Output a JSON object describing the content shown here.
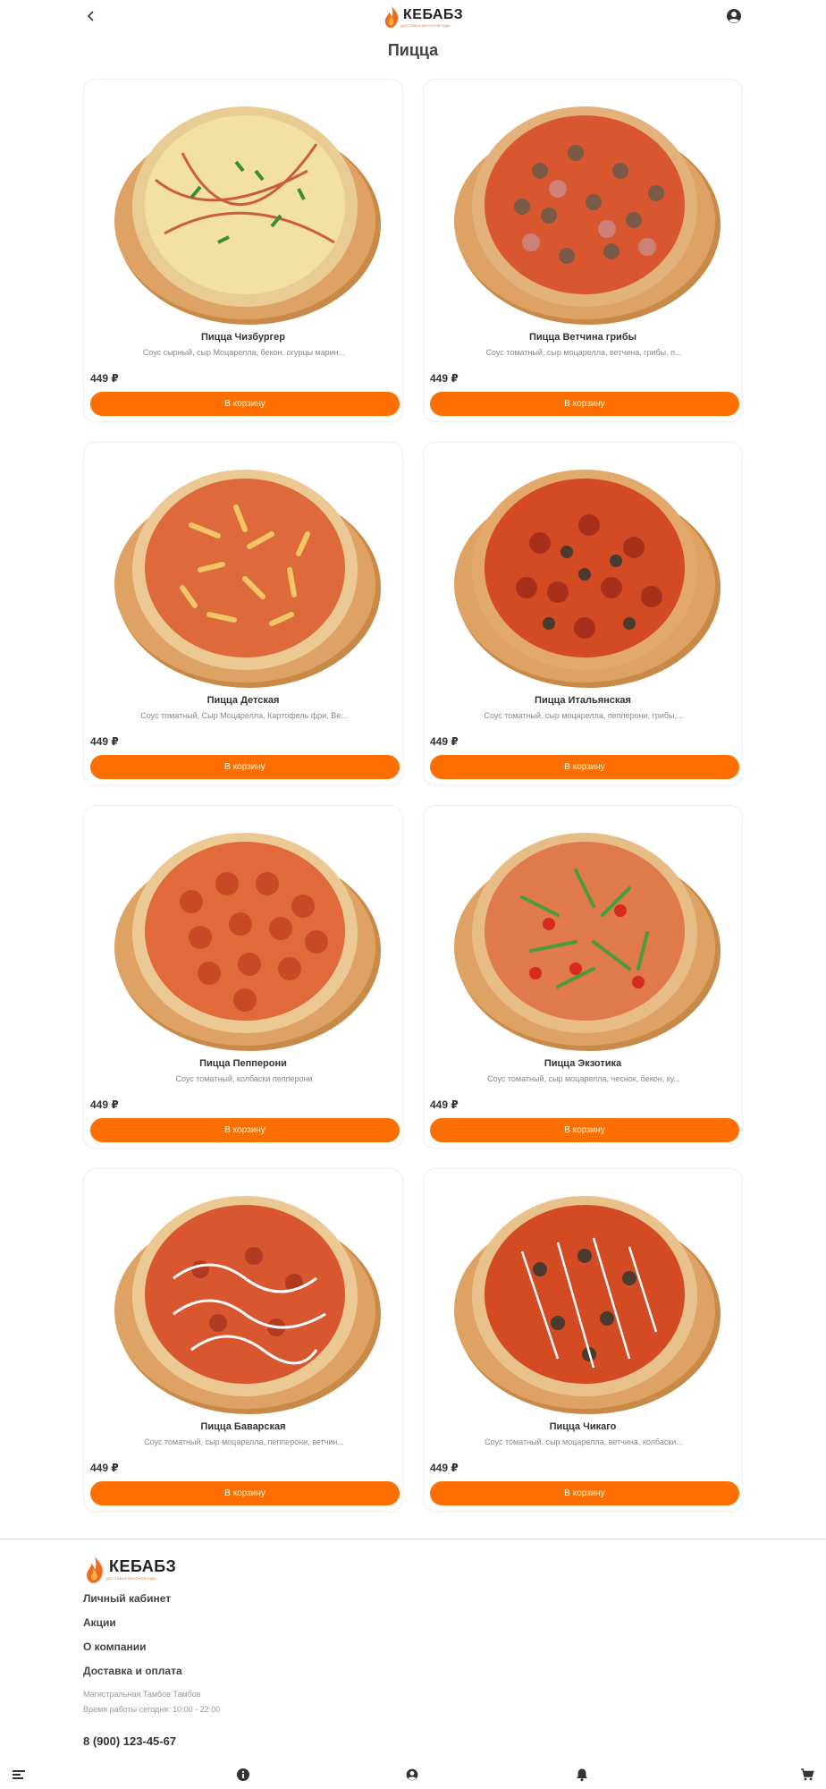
{
  "header": {
    "back_icon": "chevron-left-icon",
    "account_icon": "account-circle-icon",
    "logo_text": "КЕБАБЗ",
    "logo_tagline": "ДОСТАВКА ВКУСНОЙ ЕДЫ"
  },
  "page": {
    "title": "Пицца"
  },
  "products": [
    {
      "name": "Пицца Чизбургер",
      "description": "Соус сырный, сыр Моцарелла, бекон, огурцы марин...",
      "price": "449 ₽",
      "button": "В корзину",
      "image": "pizza-cheeseburger"
    },
    {
      "name": "Пицца Ветчина грибы",
      "description": "Соус томатный, сыр моцарелла, ветчина, грибы, п...",
      "price": "449 ₽",
      "button": "В корзину",
      "image": "pizza-ham-mushrooms"
    },
    {
      "name": "Пицца Детская",
      "description": "Соус томатный, Сыр Моцарелла, Картофель фри, Ве...",
      "price": "449 ₽",
      "button": "В корзину",
      "image": "pizza-kids"
    },
    {
      "name": "Пицца Итальянская",
      "description": "Соус томатный, сыр моцарелла, пепперони, грибы,...",
      "price": "449 ₽",
      "button": "В корзину",
      "image": "pizza-italian"
    },
    {
      "name": "Пицца Пепперони",
      "description": "Соус томатный, колбаски пепперони",
      "price": "449 ₽",
      "button": "В корзину",
      "image": "pizza-pepperoni"
    },
    {
      "name": "Пицца Экзотика",
      "description": "Соус томатный, сыр моцарелла, чеснок, бекон, ку...",
      "price": "449 ₽",
      "button": "В корзину",
      "image": "pizza-exotic"
    },
    {
      "name": "Пицца Баварская",
      "description": "Соус томатный, сыр моцарелла, пепперони, ветчин...",
      "price": "449 ₽",
      "button": "В корзину",
      "image": "pizza-bavarian"
    },
    {
      "name": "Пицца Чикаго",
      "description": "Соус томатный, сыр моцарелла, ветчина, колбаски...",
      "price": "449 ₽",
      "button": "В корзину",
      "image": "pizza-chicago"
    }
  ],
  "footer": {
    "logo_text": "КЕБАБЗ",
    "logo_tagline": "ДОСТАВКА ВКУСНОЙ ЕДЫ",
    "links": [
      "Личный кабинет",
      "Акции",
      "О компании",
      "Доставка и оплата"
    ],
    "address": "Магистральная Тамбов Тамбов",
    "hours": "Время работы сегодня: 10:00 - 22:00",
    "phone": "8 (900) 123-45-67"
  },
  "bottom_nav": {
    "icons": [
      "menu-icon",
      "info-icon",
      "account-icon",
      "bell-icon",
      "cart-icon"
    ]
  },
  "colors": {
    "accent": "#ff6f00",
    "text": "#333333",
    "muted": "#888888"
  }
}
